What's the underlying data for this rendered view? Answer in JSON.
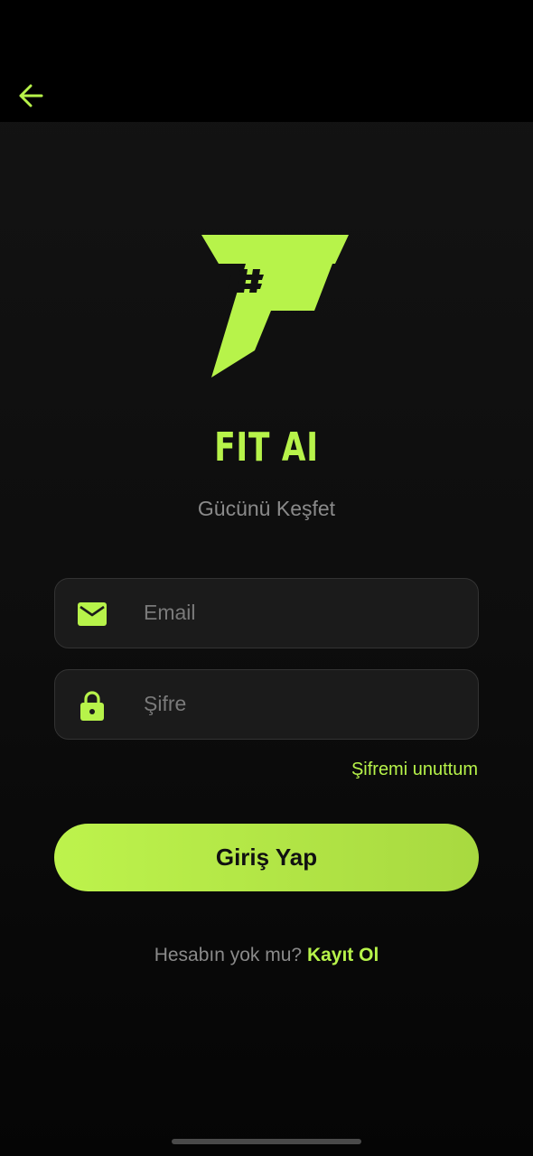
{
  "header": {
    "back_icon": "arrow-left-icon"
  },
  "brand": {
    "logo_icon": "fit-ai-f-logo",
    "title": "FIT AI",
    "tagline": "Gücünü Keşfet"
  },
  "form": {
    "email": {
      "icon": "mail-icon",
      "placeholder": "Email",
      "value": ""
    },
    "password": {
      "icon": "lock-icon",
      "placeholder": "Şifre",
      "value": ""
    },
    "forgot_label": "Şifremi unuttum",
    "submit_label": "Giriş Yap"
  },
  "signup": {
    "prompt": "Hesabın yok mu?",
    "link_label": "Kayıt Ol"
  },
  "colors": {
    "accent": "#b7f34a",
    "background": "#0d0d0d",
    "field_bg": "#1b1b1b",
    "muted_text": "#8a8a8a"
  }
}
